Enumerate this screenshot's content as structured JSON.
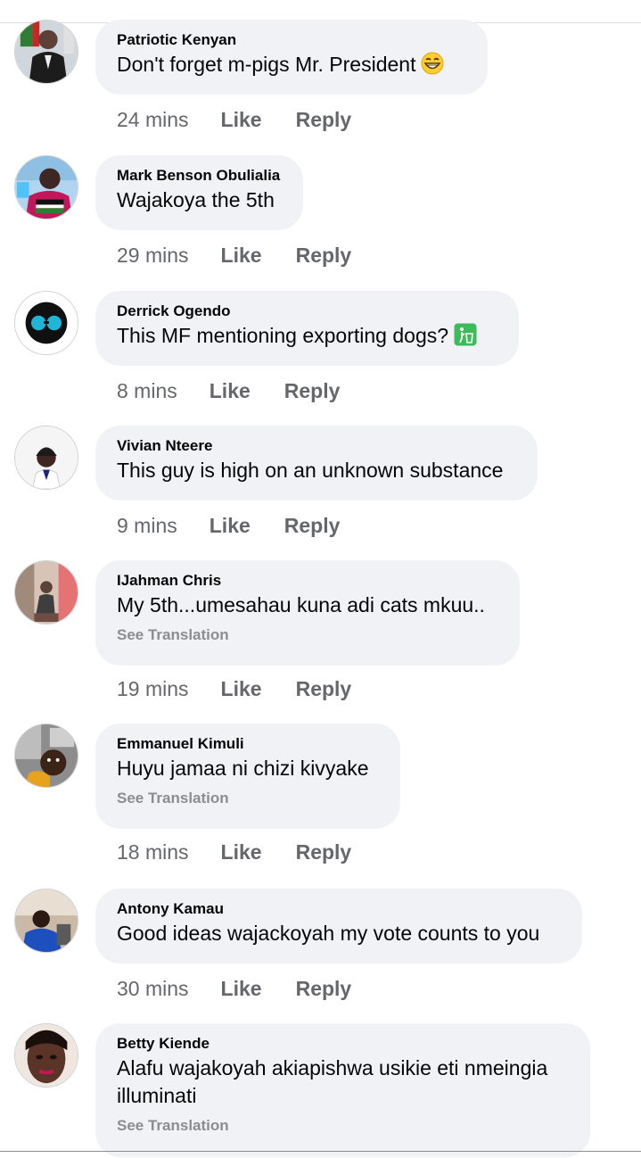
{
  "comments": [
    {
      "author": "Patriotic Kenyan",
      "text": "Don't forget m-pigs Mr. President",
      "emoji": "grinning-face-icon",
      "time": "24 mins",
      "like": "Like",
      "reply": "Reply"
    },
    {
      "author": "Mark Benson Obulialia",
      "text": "Wajakoya the 5th",
      "time": "29 mins",
      "like": "Like",
      "reply": "Reply"
    },
    {
      "author": "Derrick Ogendo",
      "text": "This MF mentioning exporting dogs?",
      "emoji": "put-litter-in-bin-icon",
      "time": "8 mins",
      "like": "Like",
      "reply": "Reply"
    },
    {
      "author": "Vivian Nteere",
      "text": "This guy is high on an unknown substance",
      "time": "9 mins",
      "like": "Like",
      "reply": "Reply"
    },
    {
      "author": "IJahman Chris",
      "text": "My 5th...umesahau kuna adi cats mkuu..",
      "see_translation": "See Translation",
      "time": "19 mins",
      "like": "Like",
      "reply": "Reply"
    },
    {
      "author": "Emmanuel Kimuli",
      "text": "Huyu jamaa ni chizi kivyake",
      "see_translation": "See Translation",
      "time": "18 mins",
      "like": "Like",
      "reply": "Reply"
    },
    {
      "author": "Antony Kamau",
      "text": "Good ideas wajackoyah my vote counts to you",
      "time": "30 mins",
      "like": "Like",
      "reply": "Reply"
    },
    {
      "author": "Betty Kiende",
      "text": "Alafu wajakoyah akiapishwa usikie eti nmeingia illuminati",
      "see_translation": "See Translation"
    }
  ],
  "colors": {
    "bubble_bg": "#f0f2f5",
    "secondary_text": "#65676b",
    "translation_text": "#8a8d91"
  }
}
